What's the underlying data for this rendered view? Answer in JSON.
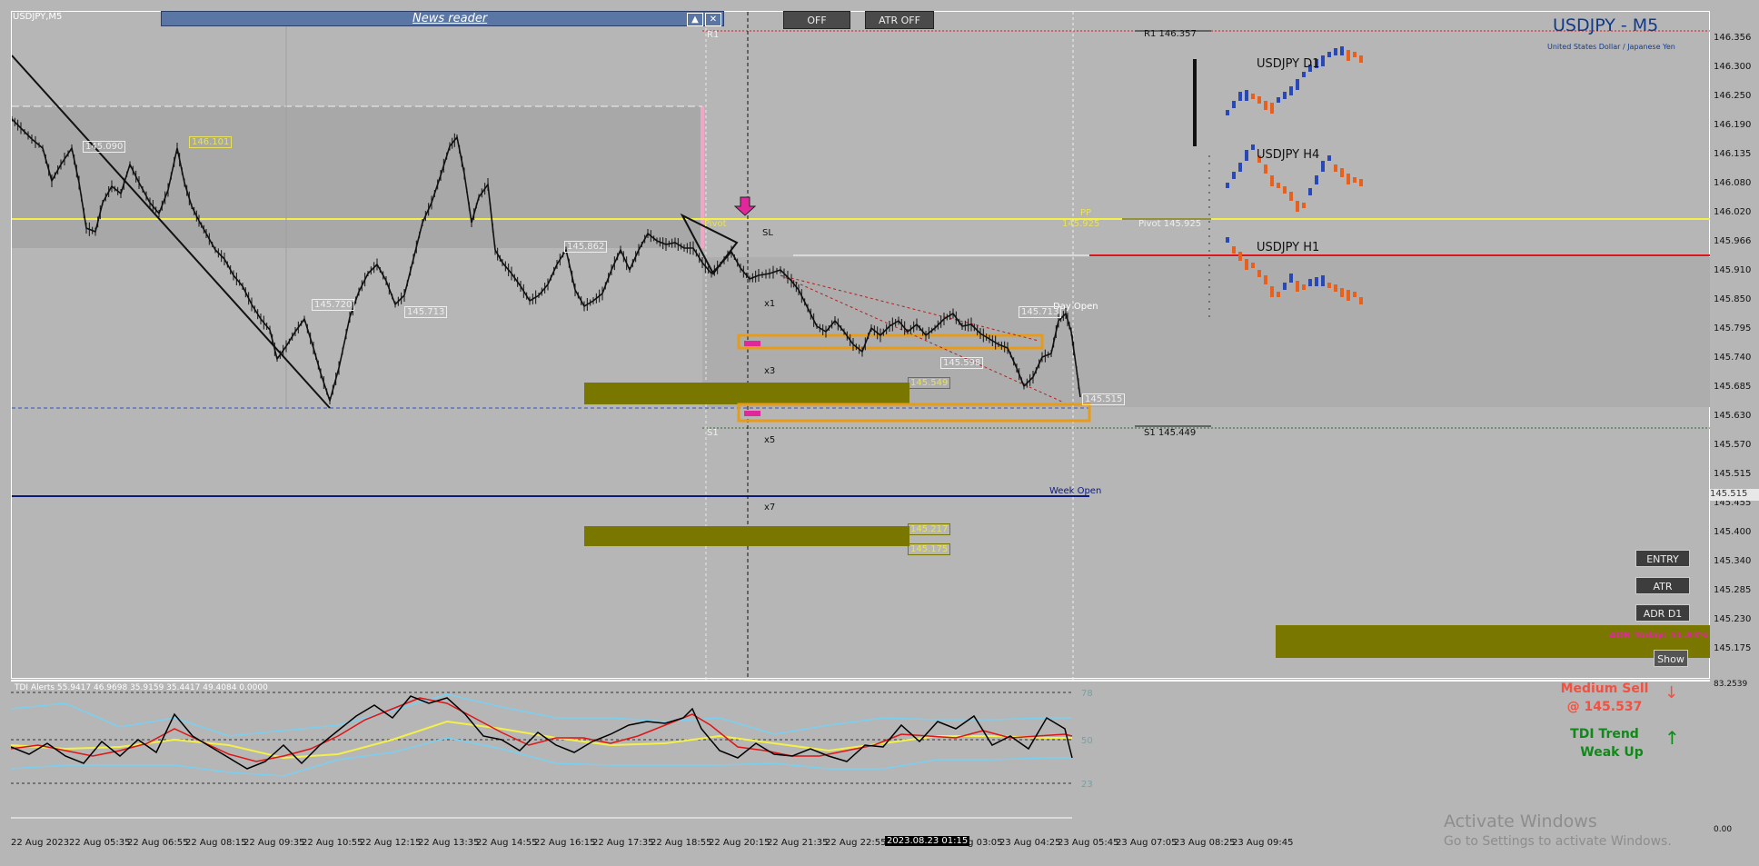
{
  "top": {
    "symbol": "USDJPY,M5",
    "news_reader": "News reader",
    "btn_up": "▲",
    "btn_close": "✕",
    "off": "OFF",
    "atr_off": "ATR OFF"
  },
  "header": {
    "title": "USDJPY - M5",
    "subtitle": "United States Dollar / Japanese Yen"
  },
  "timeframes": {
    "d1": "USDJPY D1",
    "h4": "USDJPY H4",
    "h1": "USDJPY H1"
  },
  "levels": {
    "r1": "R1 146.357",
    "r1_short": "R1",
    "pivot": "Pivot 145.925",
    "pp": "PP",
    "pp_price": "145.925",
    "day_open": "Day Open",
    "s1": "S1 145.449",
    "s1_short": "S1",
    "week_open": "Week Open",
    "pivot_short": "Pivot"
  },
  "tags": [
    "145.090",
    "146.101",
    "145.862",
    "145.720",
    "145.713",
    "145.713",
    "145.598",
    "145.515",
    "145.549",
    "145.217",
    "145.175"
  ],
  "x_levels": {
    "sl": "SL",
    "x1": "x1",
    "x3": "x3",
    "x5": "x5",
    "x7": "x7"
  },
  "price_axis": {
    "labels": [
      "146.356",
      "146.300",
      "146.250",
      "146.190",
      "146.135",
      "146.080",
      "146.020",
      "145.966",
      "145.910",
      "145.850",
      "145.795",
      "145.740",
      "145.685",
      "145.630",
      "145.570",
      "145.515",
      "145.455",
      "145.400",
      "145.340",
      "145.285",
      "145.230",
      "145.175"
    ],
    "current": "145.515",
    "ind_top": "83.2539",
    "ind_bottom": "0.00"
  },
  "time_axis": {
    "labels": [
      "22 Aug 2023",
      "22 Aug 05:35",
      "22 Aug 06:55",
      "22 Aug 08:15",
      "22 Aug 09:35",
      "22 Aug 10:55",
      "22 Aug 12:15",
      "22 Aug 13:35",
      "22 Aug 14:55",
      "22 Aug 16:15",
      "22 Aug 17:35",
      "22 Aug 18:55",
      "22 Aug 20:15",
      "22 Aug 21:35",
      "22 Aug 22:55",
      "Aug 01:45",
      "23 Aug 03:05",
      "23 Aug 04:25",
      "23 Aug 05:45",
      "23 Aug 07:05",
      "23 Aug 08:25",
      "23 Aug 09:45"
    ],
    "cursor": "2023.08.23 01:15"
  },
  "buttons": {
    "entry": "ENTRY",
    "atr": "ATR",
    "adr": "ADR D1",
    "show": "Show"
  },
  "indicator": {
    "name": "TDI Alerts 55.9417 46.9698 35.9159 35.4417 49.4084 0.0000",
    "lvl_78": "78",
    "lvl_50": "50",
    "lvl_23": "23",
    "signal1": "Medium Sell",
    "signal1_price": "@ 145.537",
    "signal2": "TDI Trend",
    "signal2_sub": "Weak Up"
  },
  "watermark": {
    "title": "Activate Windows",
    "sub": "Go to Settings to activate Windows."
  },
  "colors": {
    "pp_line": "#f3f04a",
    "day_open": "#e0141c",
    "week_open": "#0e1a7a",
    "zone": "#7a7700",
    "box": "#e89b16",
    "sell": "#f35040",
    "buy": "#0f8a18"
  }
}
